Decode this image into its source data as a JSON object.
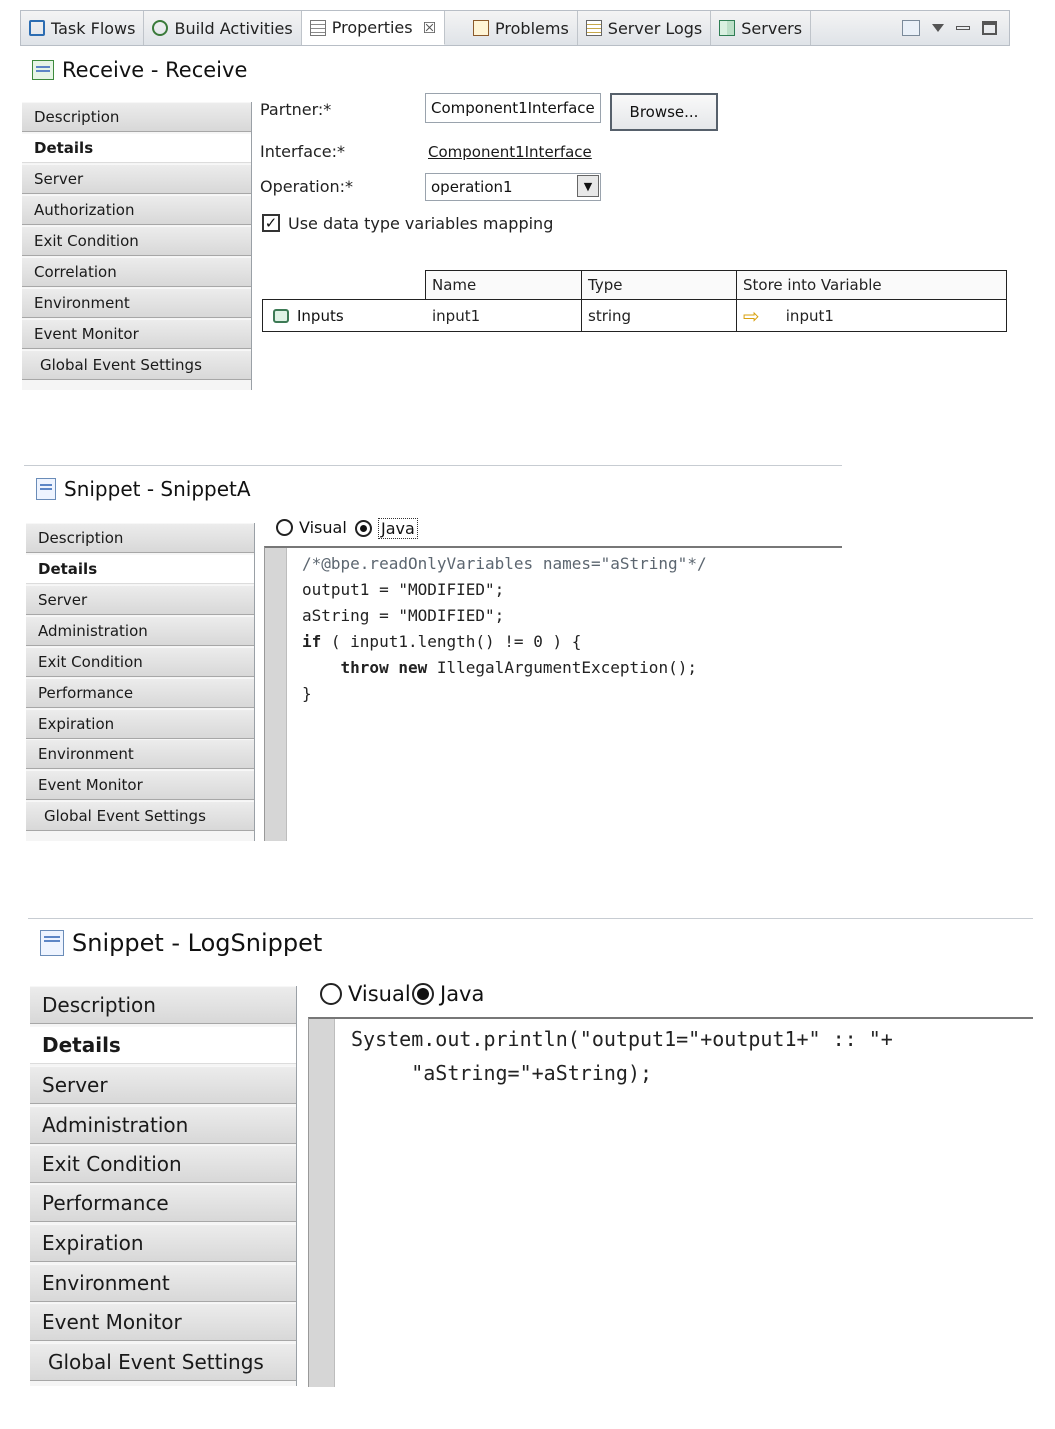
{
  "tabs": [
    {
      "label": "Task Flows",
      "icon": "task-flows-icon"
    },
    {
      "label": "Build Activities",
      "icon": "build-activities-icon"
    },
    {
      "label": "Properties",
      "icon": "properties-icon",
      "active": true
    },
    {
      "label": "Problems",
      "icon": "problems-icon"
    },
    {
      "label": "Server Logs",
      "icon": "server-logs-icon"
    },
    {
      "label": "Servers",
      "icon": "servers-icon"
    }
  ],
  "close_glyph": "☒",
  "receive": {
    "title": "Receive - Receive",
    "sidebar": [
      "Description",
      "Details",
      "Server",
      "Authorization",
      "Exit Condition",
      "Correlation",
      "Environment",
      "Event Monitor",
      "Global Event Settings"
    ],
    "partner_label": "Partner:*",
    "partner_value": "Component1Interface",
    "browse_label": "Browse...",
    "interface_label": "Interface:*",
    "interface_value": "Component1Interface",
    "operation_label": "Operation:*",
    "operation_value": "operation1",
    "checkbox_label": "Use data type variables mapping",
    "table_headers": [
      "Name",
      "Type",
      "Store into Variable"
    ],
    "row_label": "Inputs",
    "row": {
      "name": "input1",
      "type": "string",
      "variable": "input1"
    }
  },
  "snippetA": {
    "title": "Snippet - SnippetA",
    "sidebar": [
      "Description",
      "Details",
      "Server",
      "Administration",
      "Exit Condition",
      "Performance",
      "Expiration",
      "Environment",
      "Event Monitor",
      "Global Event Settings"
    ],
    "radio_visual": "Visual",
    "radio_java": "Java",
    "code": [
      "/*@bpe.readOnlyVariables names=\"aString\"*/",
      "output1 = \"MODIFIED\";",
      "aString = \"MODIFIED\";",
      "if ( input1.length() != 0 ) {",
      "    throw new IllegalArgumentException();",
      "}"
    ]
  },
  "logSnippet": {
    "title": "Snippet - LogSnippet",
    "sidebar": [
      "Description",
      "Details",
      "Server",
      "Administration",
      "Exit Condition",
      "Performance",
      "Expiration",
      "Environment",
      "Event Monitor",
      "Global Event Settings"
    ],
    "radio_visual": "Visual",
    "radio_java": "Java",
    "code": [
      "System.out.println(\"output1=\"+output1+\" :: \"+",
      "     \"aString=\"+aString);"
    ]
  }
}
